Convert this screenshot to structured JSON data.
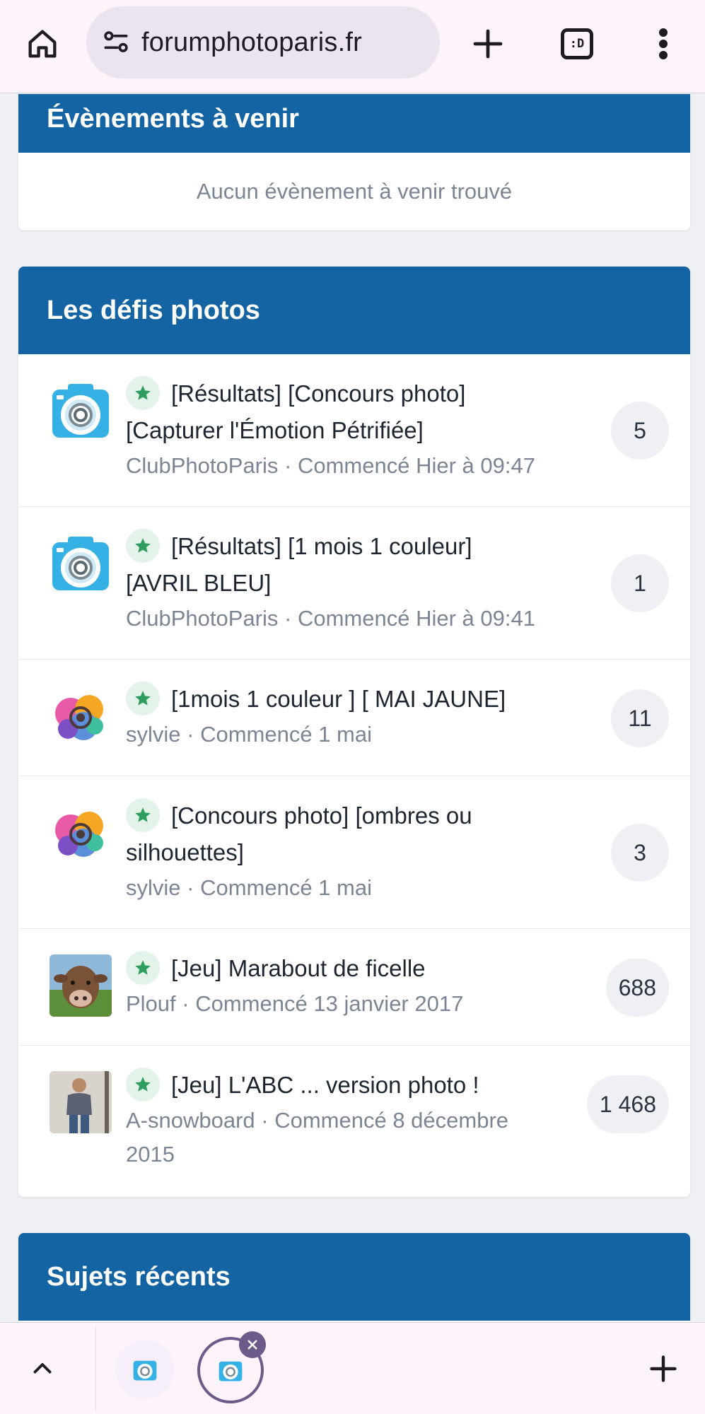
{
  "browser": {
    "url": "forumphotoparis.fr",
    "tab_count_label": ":D",
    "icons": [
      "home-icon",
      "site-settings-icon",
      "new-tab-icon",
      "tab-switcher-icon",
      "overflow-menu-icon"
    ]
  },
  "events": {
    "title": "Évènements à venir",
    "empty_message": "Aucun évènement à venir trouvé"
  },
  "challenges": {
    "title": "Les défis photos",
    "topics": [
      {
        "title_1": "[Résultats] [Concours photo]",
        "title_2": "[Capturer l'Émotion Pétrifiée]",
        "author": "ClubPhotoParis",
        "started": "Commencé Hier à 09:47",
        "replies": "5",
        "avatar": "camera-logo"
      },
      {
        "title_1": "[Résultats] [1 mois 1 couleur]",
        "title_2": "[AVRIL BLEU]",
        "author": "ClubPhotoParis",
        "started": "Commencé Hier à 09:41",
        "replies": "1",
        "avatar": "camera-logo"
      },
      {
        "title_1": "[1mois 1 couleur ] [ MAI JAUNE]",
        "author": "sylvie",
        "started": "Commencé 1 mai",
        "replies": "11",
        "avatar": "colorful-art"
      },
      {
        "title_1": "[Concours photo] [ombres ou",
        "title_2": "silhouettes]",
        "author": "sylvie",
        "started": "Commencé 1 mai",
        "replies": "3",
        "avatar": "colorful-art"
      },
      {
        "title_1": "[Jeu] Marabout de ficelle",
        "author": "Plouf",
        "started": "Commencé 13 janvier 2017",
        "replies": "688",
        "avatar": "cow-photo"
      },
      {
        "title_1": "[Jeu] L'ABC ... version photo !",
        "author": "A-snowboard",
        "started_1": "Commencé 8 décembre",
        "started_2": "2015",
        "replies": "1 468",
        "avatar": "person-photo"
      }
    ]
  },
  "recent": {
    "title": "Sujets récents"
  },
  "colors": {
    "header_blue": "#1463a3",
    "pin_green": "#2e9e5e",
    "meta_gray": "#7b8593"
  }
}
